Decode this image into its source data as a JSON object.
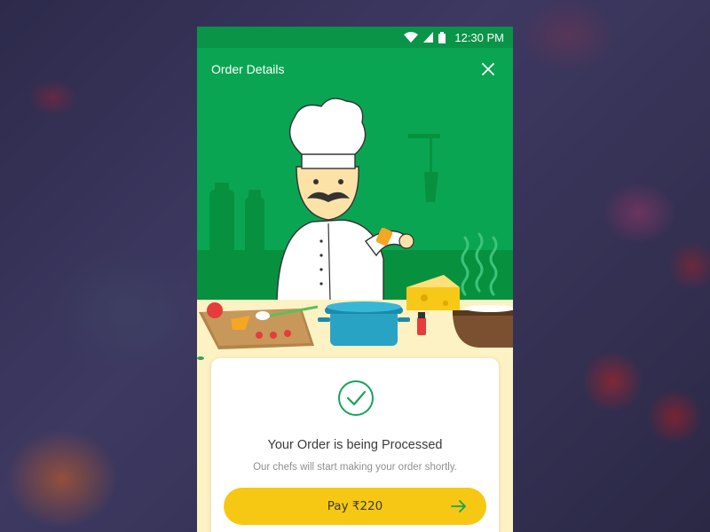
{
  "status_bar": {
    "time": "12:30 PM",
    "icons": [
      "wifi-icon",
      "signal-icon",
      "battery-icon"
    ]
  },
  "app_bar": {
    "title": "Order Details",
    "close_icon": "close-icon"
  },
  "illustration": {
    "subject": "chef-cooking-icon"
  },
  "order_card": {
    "status_icon": "check-circle-icon",
    "title": "Your Order is being Processed",
    "subtitle": "Our chefs will start making your order shortly.",
    "pay_button_label": "Pay ₹220",
    "pay_button_icon": "arrow-right-icon"
  },
  "colors": {
    "status_bar": "#099447",
    "app_bar": "#0aa552",
    "counter": "#fdf2c4",
    "accent_green": "#16a35a",
    "button_yellow": "#f6c813"
  }
}
